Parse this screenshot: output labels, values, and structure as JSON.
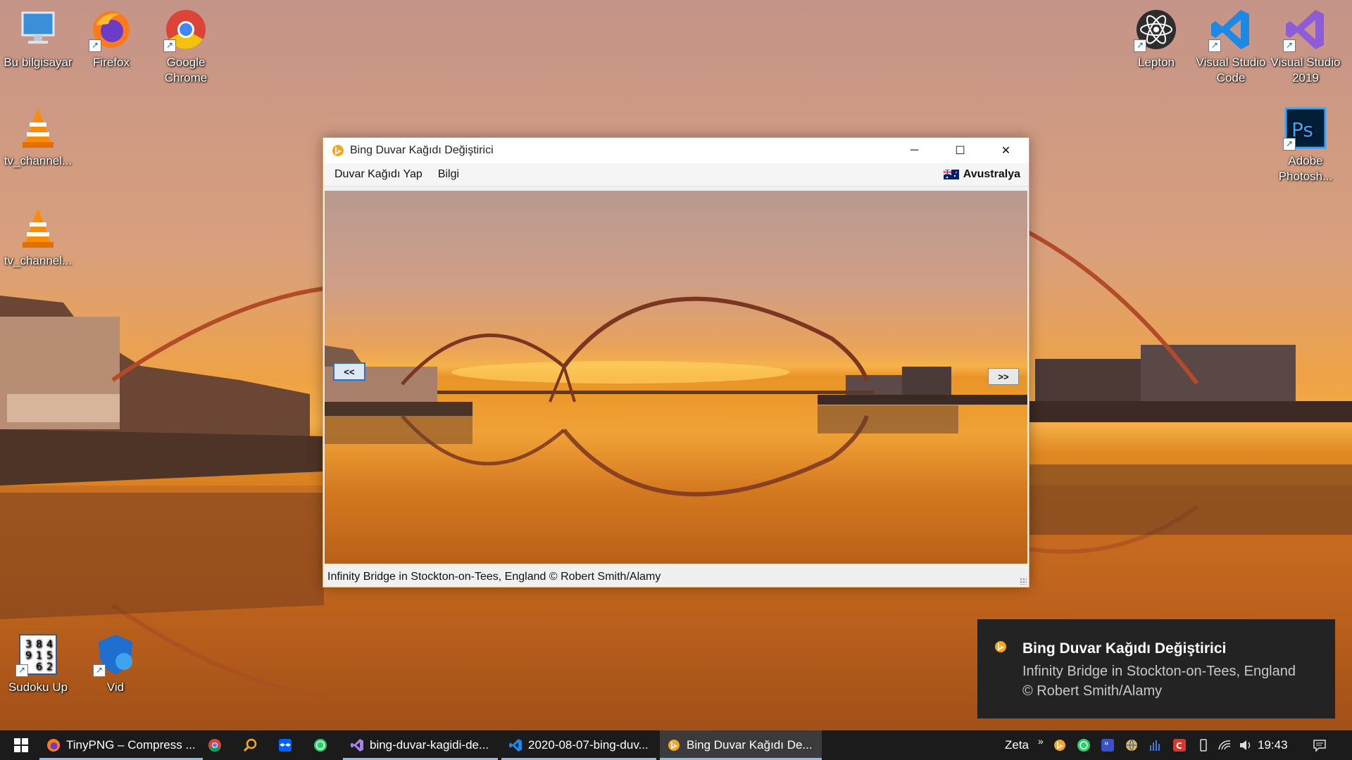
{
  "desktop": {
    "icons_left": [
      {
        "label": "Bu bilgisayar",
        "icon": "computer-icon"
      },
      {
        "label": "Firefox",
        "icon": "firefox-icon"
      },
      {
        "label": "Google Chrome",
        "icon": "chrome-icon"
      },
      {
        "label": "tv_channel...",
        "icon": "vlc-icon"
      },
      {
        "label": "tv_channel...",
        "icon": "vlc-icon"
      },
      {
        "label": "Sudoku Up",
        "icon": "sudoku-icon"
      },
      {
        "label": "Vid",
        "icon": "shield-icon"
      }
    ],
    "icons_right": [
      {
        "label": "Lepton",
        "icon": "lepton-icon"
      },
      {
        "label": "Visual Studio Code",
        "icon": "vscode-icon"
      },
      {
        "label": "Visual Studio 2019",
        "icon": "visual-studio-icon"
      },
      {
        "label": "Adobe Photosh...",
        "icon": "photoshop-icon"
      }
    ],
    "sudoku_digits": [
      "3",
      "8",
      "4",
      "9",
      "1",
      "5",
      "",
      "6",
      "2"
    ],
    "photoshop_glyph": "Ps"
  },
  "window": {
    "title": "Bing Duvar Kağıdı Değiştirici",
    "menu": [
      "Duvar Kağıdı Yap",
      "Bilgi"
    ],
    "region": "Avustralya",
    "prev_label": "<<",
    "next_label": ">>",
    "caption": "Infinity Bridge in Stockton-on-Tees, England © Robert Smith/Alamy",
    "controls": {
      "minimize": "─",
      "maximize": "☐",
      "close": "✕"
    }
  },
  "toast": {
    "title": "Bing Duvar Kağıdı Değiştirici",
    "body": "Infinity Bridge in Stockton-on-Tees, England © Robert Smith/Alamy"
  },
  "taskbar": {
    "apps": [
      {
        "label": "TinyPNG – Compress ...",
        "icon": "firefox-icon"
      },
      {
        "label": "",
        "icon": "chrome-icon"
      },
      {
        "label": "",
        "icon": "search-icon"
      },
      {
        "label": "",
        "icon": "dropbox-icon"
      },
      {
        "label": "",
        "icon": "whatsapp-icon"
      },
      {
        "label": "bing-duvar-kagidi-de...",
        "icon": "visual-studio-icon"
      },
      {
        "label": "2020-08-07-bing-duv...",
        "icon": "vscode-icon"
      },
      {
        "label": "Bing Duvar Kağıdı De...",
        "icon": "bing-icon"
      }
    ],
    "weather_label": "Zeta",
    "overflow": "»",
    "clock": "19:43"
  },
  "colors": {
    "accent": "#e5a760",
    "toast_bg": "#232323",
    "taskbar_bg": "#1b1b1b",
    "bing_orange": "#f5a623"
  }
}
